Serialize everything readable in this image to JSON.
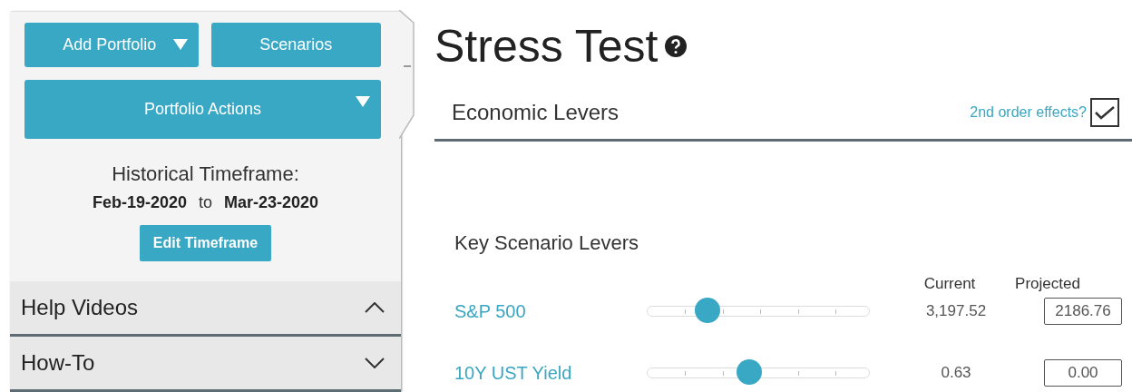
{
  "sidebar": {
    "buttons": [
      {
        "label": "Add Portfolio",
        "kind": "dropdown"
      },
      {
        "label": "Scenarios",
        "kind": "plain"
      },
      {
        "label": "Portfolio Actions",
        "kind": "dropdown"
      }
    ],
    "timeframe": {
      "title": "Historical Timeframe:",
      "start": "Feb-19-2020",
      "separator": "to",
      "end": "Mar-23-2020",
      "button": "Edit Timeframe"
    },
    "sections": [
      {
        "label": "Help Videos",
        "expanded": true
      },
      {
        "label": "How-To",
        "expanded": false
      }
    ]
  },
  "main": {
    "title": "Stress Test",
    "section": "Economic Levers",
    "option": {
      "label": "2nd order effects?",
      "checked": true
    },
    "levers": {
      "title": "Key Scenario Levers",
      "columns": [
        "Current",
        "Projected"
      ],
      "rows": [
        {
          "name": "S&P 500",
          "level": 0.27,
          "current": "3,197.52",
          "projected": "2186.76"
        },
        {
          "name": "10Y UST Yield",
          "level": 0.46,
          "current": "0.63",
          "projected": "0.00"
        }
      ]
    }
  }
}
